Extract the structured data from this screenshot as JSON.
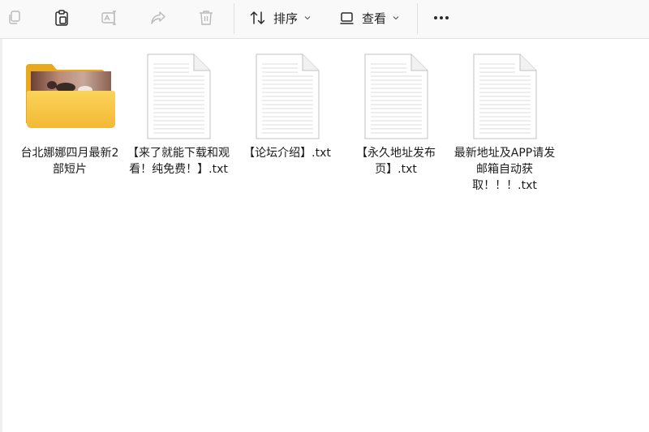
{
  "toolbar": {
    "sort_label": "排序",
    "view_label": "查看",
    "icons": [
      "copy-icon",
      "paste-icon",
      "rename-icon",
      "share-icon",
      "delete-icon",
      "sort-icon",
      "view-icon",
      "more-icon"
    ]
  },
  "files": [
    {
      "name": "台北娜娜四月最新2部短片",
      "type": "folder"
    },
    {
      "name": "【来了就能下载和观看！纯免费！】.txt",
      "type": "txt"
    },
    {
      "name": "【论坛介绍】.txt",
      "type": "txt"
    },
    {
      "name": "【永久地址发布页】.txt",
      "type": "txt"
    },
    {
      "name": "最新地址及APP请发邮箱自动获取！！！.txt",
      "type": "txt"
    }
  ],
  "colors": {
    "folder": "#f8c640",
    "folder_back": "#e8a820",
    "toolbar_bg": "#f9f9f9",
    "icon_disabled": "#b9b9b9",
    "icon_active": "#2b2b2b"
  }
}
